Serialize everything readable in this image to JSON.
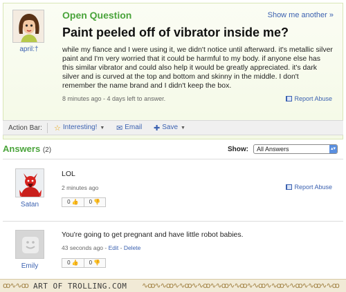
{
  "question": {
    "type_label": "Open Question",
    "show_another": "Show me another »",
    "title": "Paint peeled off of vibrator inside me?",
    "body": "while my fiance and I were using it, we didn't notice until afterward. it's metallic silver paint and I'm very worried that it could be harmful to my body. if anyone else has this similar vibrator and could also help it would be greatly appreciated. it's dark silver and is curved at the top and bottom and skinny in the middle. I don't remember the name brand and I didn't keep the box.",
    "meta": "8 minutes ago - 4 days left to answer.",
    "report_abuse": "Report Abuse",
    "asker": {
      "name": "april:†"
    }
  },
  "action_bar": {
    "label": "Action Bar:",
    "interesting": "Interesting!",
    "email": "Email",
    "save": "Save"
  },
  "answers": {
    "heading": "Answers",
    "count": "(2)",
    "show_label": "Show:",
    "show_selected": "All Answers",
    "items": [
      {
        "name": "Satan",
        "text": "LOL",
        "time": "2 minutes ago",
        "report_abuse": "Report Abuse",
        "thumbs_up": "0",
        "thumbs_down": "0"
      },
      {
        "name": "Emily",
        "text": "You're going to get pregnant and have little robot babies.",
        "time": "43 seconds ago",
        "edit": "Edit",
        "delete": "Delete",
        "sep": " - ",
        "thumbs_up": "0",
        "thumbs_down": "0"
      }
    ]
  },
  "footer": {
    "text": "ART OF TROLLING.COM"
  },
  "colors": {
    "green_heading": "#4aa43b",
    "link_blue": "#3b61b0",
    "question_bg": "#f4f9e6",
    "footer_bg": "#f1ead6"
  }
}
